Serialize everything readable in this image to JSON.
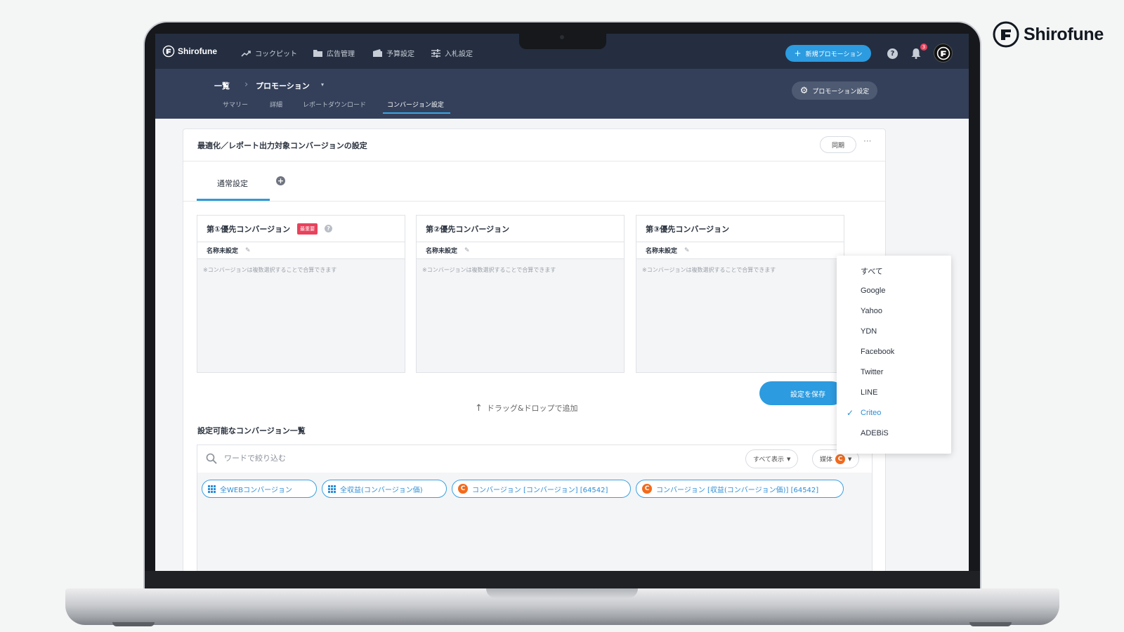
{
  "brand": {
    "name": "Shirofune"
  },
  "app": {
    "logo_text": "Shirofune",
    "nav": [
      {
        "label": "コックピット",
        "icon": "trend-up-icon"
      },
      {
        "label": "広告管理",
        "icon": "folder-icon"
      },
      {
        "label": "予算設定",
        "icon": "wallet-icon"
      },
      {
        "label": "入札設定",
        "icon": "sliders-icon"
      }
    ],
    "new_promotion_label": "新規プロモーション",
    "notification_count": "3",
    "help_label": "?"
  },
  "subheader": {
    "breadcrumb_list": "一覧",
    "breadcrumb_current": "プロモーション",
    "tabs": [
      "サマリー",
      "詳細",
      "レポートダウンロード",
      "コンバージョン設定"
    ],
    "active_tab": "コンバージョン設定",
    "promotion_settings_label": "プロモーション設定"
  },
  "card": {
    "title": "最適化／レポート出力対象コンバージョンの設定",
    "sync_label": "同期",
    "more_label": "···",
    "tab_label": "通常設定",
    "add_tab_label": "+"
  },
  "priorities": [
    {
      "title": "第①優先コンバージョン",
      "badge": "最重要",
      "name": "名称未設定",
      "hint": "※コンバージョンは複数選択することで合算できます"
    },
    {
      "title": "第②優先コンバージョン",
      "name": "名称未設定",
      "hint": "※コンバージョンは複数選択することで合算できます"
    },
    {
      "title": "第③優先コンバージョン",
      "name": "名称未設定",
      "hint": "※コンバージョンは複数選択することで合算できます"
    }
  ],
  "save_label": "設定を保存",
  "drag_hint": "ドラッグ&ドロップで追加",
  "list": {
    "title": "設定可能なコンバージョン一覧",
    "search_placeholder": "ワードで絞り込む",
    "show_all_label": "すべて表示",
    "media_label": "媒体",
    "chips": [
      {
        "label": "全WEBコンバージョン",
        "icon": "grid-icon"
      },
      {
        "label": "全収益(コンバージョン価)",
        "icon": "grid-icon"
      },
      {
        "label": "コンバージョン [コンバージョン] [64542]",
        "icon": "criteo-icon"
      },
      {
        "label": "コンバージョン [収益(コンバージョン価)] [64542]",
        "icon": "criteo-icon"
      }
    ]
  },
  "media_dropdown": {
    "options": [
      "すべて",
      "Google",
      "Yahoo",
      "YDN",
      "Facebook",
      "Twitter",
      "LINE",
      "Criteo",
      "ADEBiS"
    ],
    "selected": "Criteo"
  },
  "colors": {
    "nav_bg": "#242e40",
    "subnav_bg": "#34405a",
    "accent": "#2c9be0",
    "critical": "#e8425c",
    "criteo": "#f26b1d"
  }
}
